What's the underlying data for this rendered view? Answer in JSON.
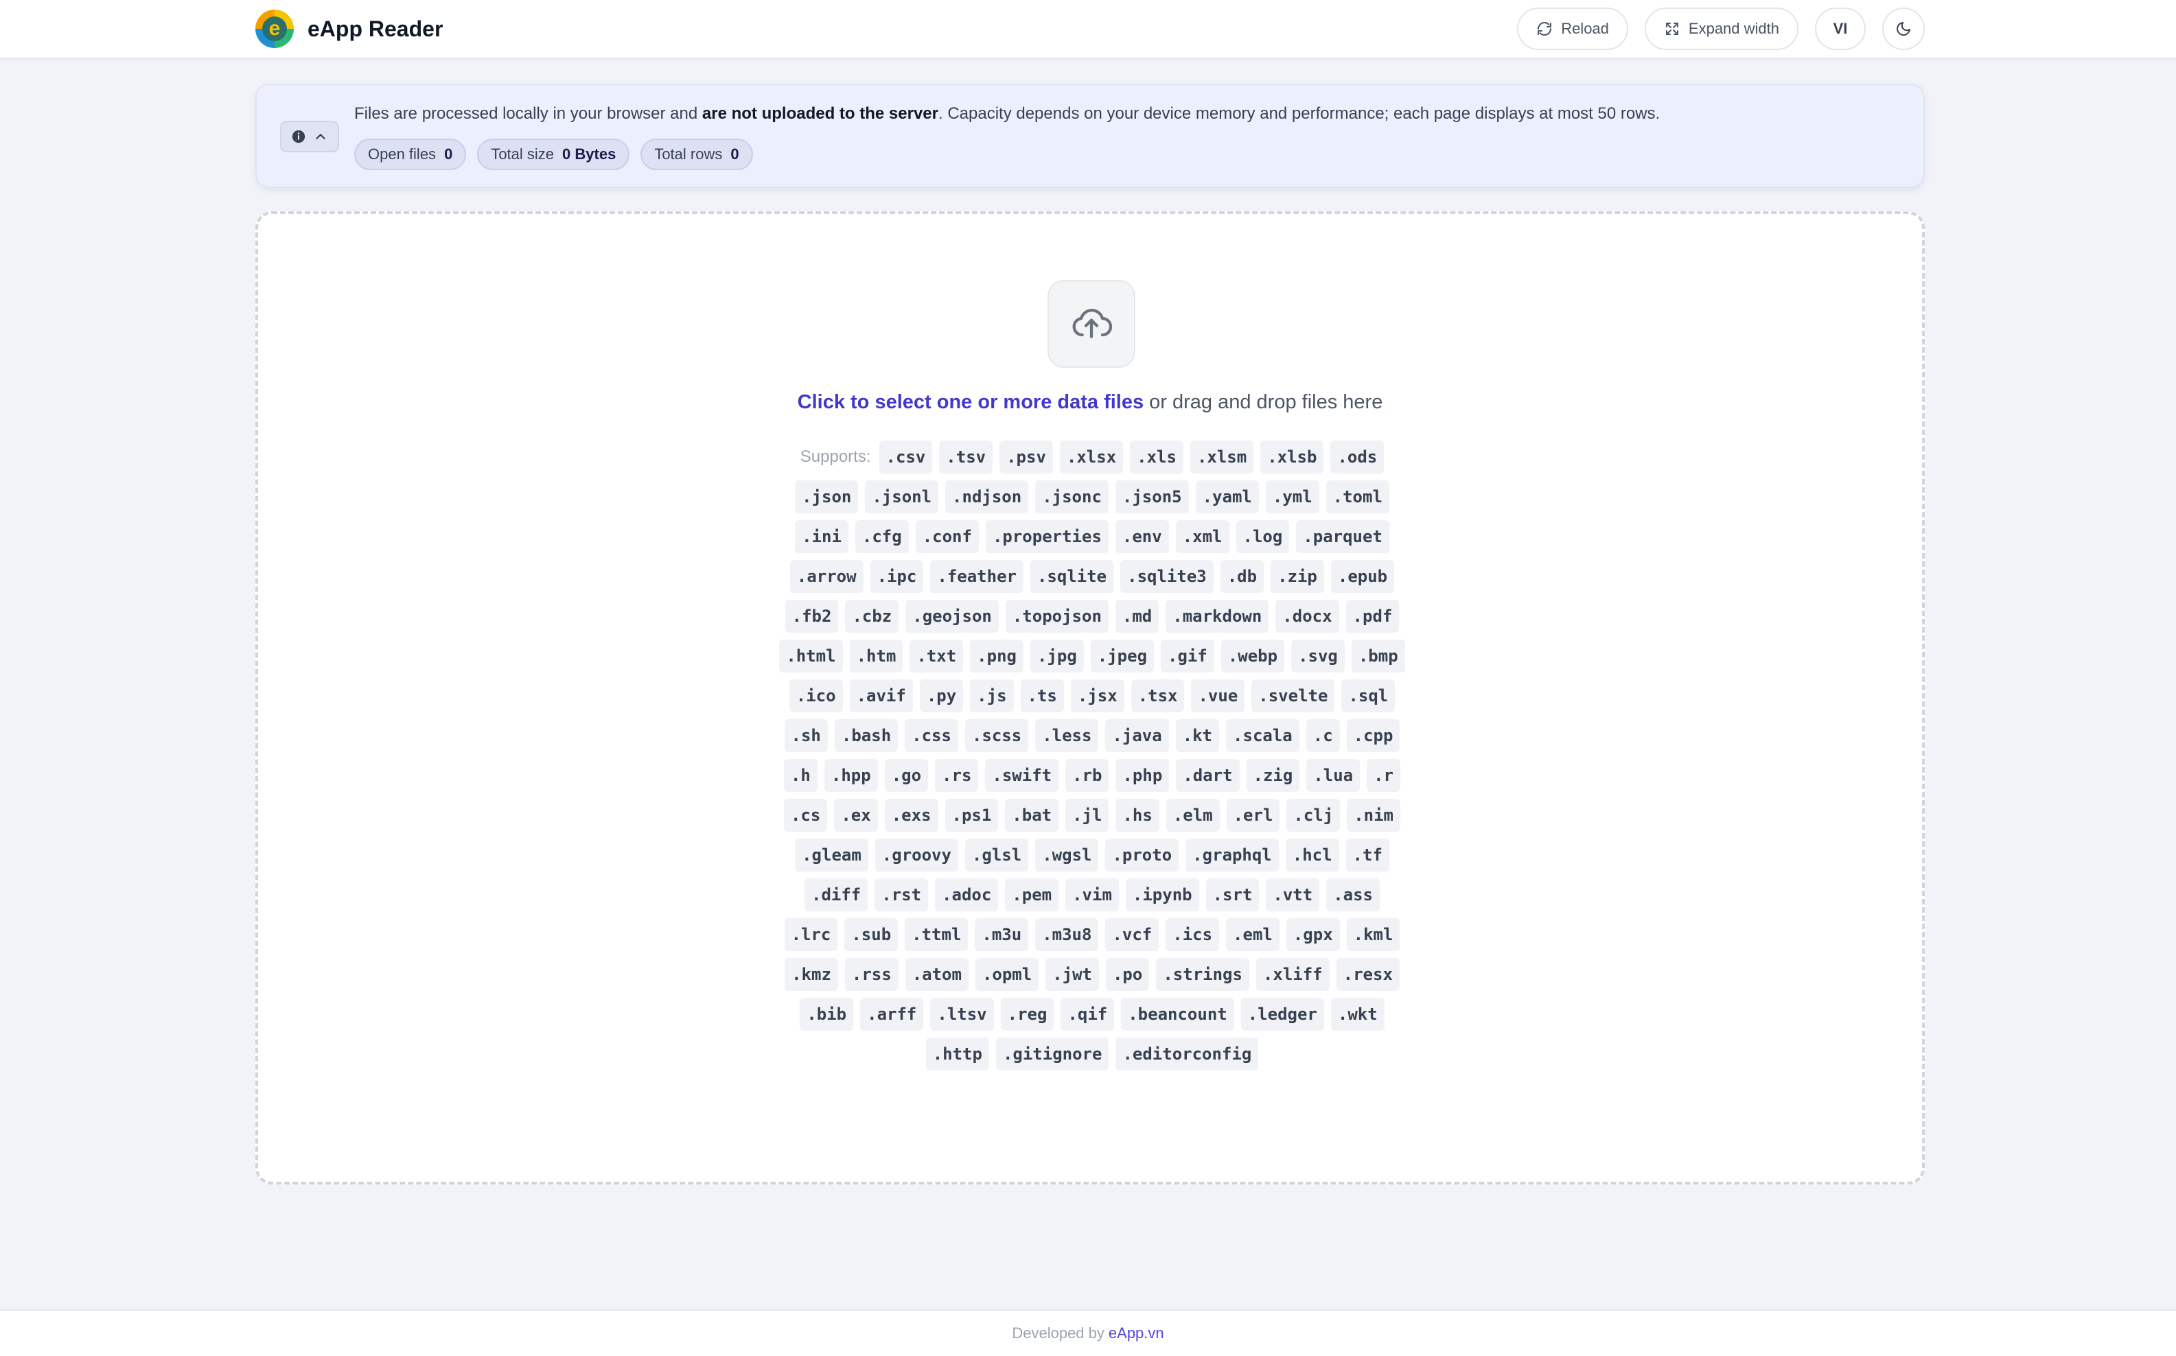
{
  "header": {
    "logo_letter": "e",
    "title": "eApp Reader",
    "reload_label": "Reload",
    "expand_label": "Expand width",
    "lang_label": "VI"
  },
  "info": {
    "text_pre": "Files are processed locally in your browser and ",
    "text_bold": "are not uploaded to the server",
    "text_post": ". Capacity depends on your device memory and performance; each page displays at most 50 rows.",
    "stats": [
      {
        "label": "Open files",
        "value": "0"
      },
      {
        "label": "Total size",
        "value": "0 Bytes"
      },
      {
        "label": "Total rows",
        "value": "0"
      }
    ]
  },
  "dropzone": {
    "link_text": "Click to select one or more data files",
    "rest_text": " or drag and drop files here",
    "supports_label": "Supports:",
    "extensions": [
      ".csv",
      ".tsv",
      ".psv",
      ".xlsx",
      ".xls",
      ".xlsm",
      ".xlsb",
      ".ods",
      ".json",
      ".jsonl",
      ".ndjson",
      ".jsonc",
      ".json5",
      ".yaml",
      ".yml",
      ".toml",
      ".ini",
      ".cfg",
      ".conf",
      ".properties",
      ".env",
      ".xml",
      ".log",
      ".parquet",
      ".arrow",
      ".ipc",
      ".feather",
      ".sqlite",
      ".sqlite3",
      ".db",
      ".zip",
      ".epub",
      ".fb2",
      ".cbz",
      ".geojson",
      ".topojson",
      ".md",
      ".markdown",
      ".docx",
      ".pdf",
      ".html",
      ".htm",
      ".txt",
      ".png",
      ".jpg",
      ".jpeg",
      ".gif",
      ".webp",
      ".svg",
      ".bmp",
      ".ico",
      ".avif",
      ".py",
      ".js",
      ".ts",
      ".jsx",
      ".tsx",
      ".vue",
      ".svelte",
      ".sql",
      ".sh",
      ".bash",
      ".css",
      ".scss",
      ".less",
      ".java",
      ".kt",
      ".scala",
      ".c",
      ".cpp",
      ".h",
      ".hpp",
      ".go",
      ".rs",
      ".swift",
      ".rb",
      ".php",
      ".dart",
      ".zig",
      ".lua",
      ".r",
      ".cs",
      ".ex",
      ".exs",
      ".ps1",
      ".bat",
      ".jl",
      ".hs",
      ".elm",
      ".erl",
      ".clj",
      ".nim",
      ".gleam",
      ".groovy",
      ".glsl",
      ".wgsl",
      ".proto",
      ".graphql",
      ".hcl",
      ".tf",
      ".diff",
      ".rst",
      ".adoc",
      ".pem",
      ".vim",
      ".ipynb",
      ".srt",
      ".vtt",
      ".ass",
      ".lrc",
      ".sub",
      ".ttml",
      ".m3u",
      ".m3u8",
      ".vcf",
      ".ics",
      ".eml",
      ".gpx",
      ".kml",
      ".kmz",
      ".rss",
      ".atom",
      ".opml",
      ".jwt",
      ".po",
      ".strings",
      ".xliff",
      ".resx",
      ".bib",
      ".arff",
      ".ltsv",
      ".reg",
      ".qif",
      ".beancount",
      ".ledger",
      ".wkt",
      ".http",
      ".gitignore",
      ".editorconfig"
    ]
  },
  "footer": {
    "prefix": "Developed by",
    "link": "eApp.vn"
  },
  "colors": {
    "accent": "#4338ca",
    "info_bg": "#eceffd",
    "page_bg": "#f1f3f8"
  }
}
